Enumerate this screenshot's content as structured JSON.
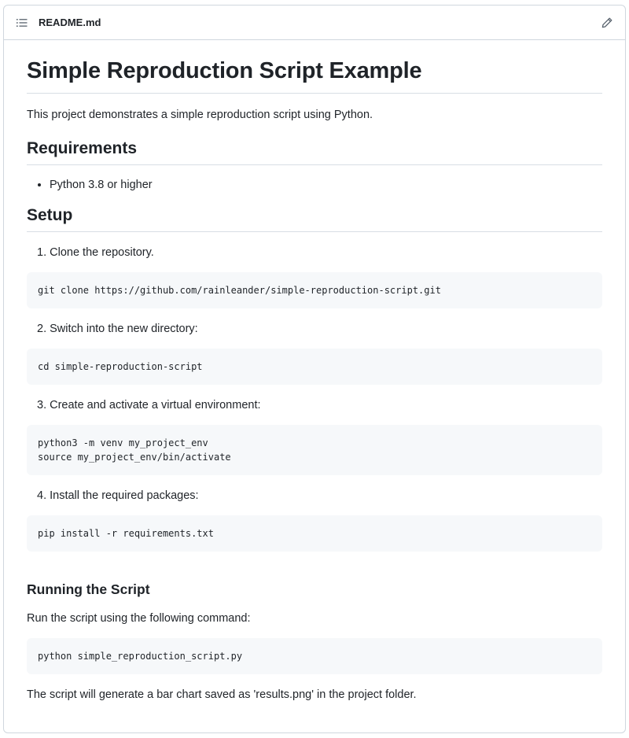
{
  "header": {
    "filename": "README.md",
    "toc_icon": "list-unordered-icon",
    "edit_icon": "pencil-icon"
  },
  "readme": {
    "title": "Simple Reproduction Script Example",
    "intro": "This project demonstrates a simple reproduction script using Python.",
    "requirements_heading": "Requirements",
    "requirements": [
      "Python 3.8 or higher"
    ],
    "setup_heading": "Setup",
    "steps": [
      {
        "label": "1. Clone the repository.",
        "code": "git clone https://github.com/rainleander/simple-reproduction-script.git"
      },
      {
        "label": "2. Switch into the new directory:",
        "code": "cd simple-reproduction-script"
      },
      {
        "label": "3. Create and activate a virtual environment:",
        "code": "python3 -m venv my_project_env\nsource my_project_env/bin/activate"
      },
      {
        "label": "4. Install the required packages:",
        "code": "pip install -r requirements.txt"
      }
    ],
    "running_heading": "Running the Script",
    "running_text": "Run the script using the following command:",
    "running_code": "python simple_reproduction_script.py",
    "final_text": "The script will generate a bar chart saved as 'results.png' in the project folder."
  }
}
